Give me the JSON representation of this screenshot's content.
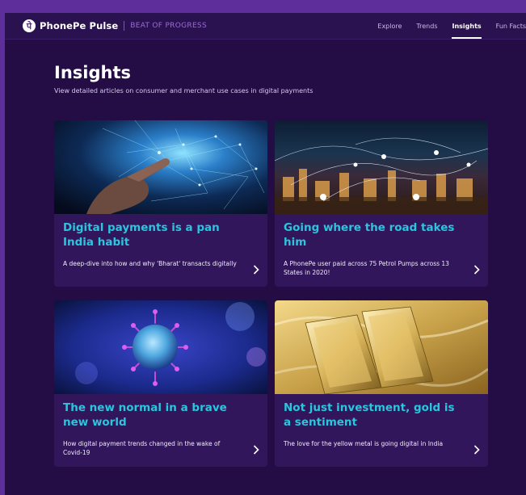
{
  "header": {
    "brand": "PhonePe Pulse",
    "tagline": "BEAT OF PROGRESS",
    "logo_glyph": "पे",
    "nav": [
      {
        "label": "Explore",
        "active": false
      },
      {
        "label": "Trends",
        "active": false
      },
      {
        "label": "Insights",
        "active": true
      },
      {
        "label": "Fun Facts",
        "active": false
      }
    ]
  },
  "page": {
    "title": "Insights",
    "subtitle": "View detailed articles on consumer and merchant use cases in digital payments"
  },
  "cards": [
    {
      "title": "Digital payments is a pan India habit",
      "description": "A deep-dive into how and why 'Bharat' transacts digitally",
      "image": "hand-network-image"
    },
    {
      "title": "Going where the road takes him",
      "description": "A PhonePe user paid across 75 Petrol Pumps across 13 States in 2020!",
      "image": "city-network-map-image"
    },
    {
      "title": "The new normal in a brave new world",
      "description": "How digital payment trends changed in the wake of Covid-19",
      "image": "virus-image"
    },
    {
      "title": "Not just investment, gold is a sentiment",
      "description": "The love for the yellow metal is going digital in India",
      "image": "gold-bars-image"
    }
  ],
  "colors": {
    "background": "#240d45",
    "card": "#32165c",
    "accent": "#29c6de",
    "frame": "#5e2e9a"
  }
}
